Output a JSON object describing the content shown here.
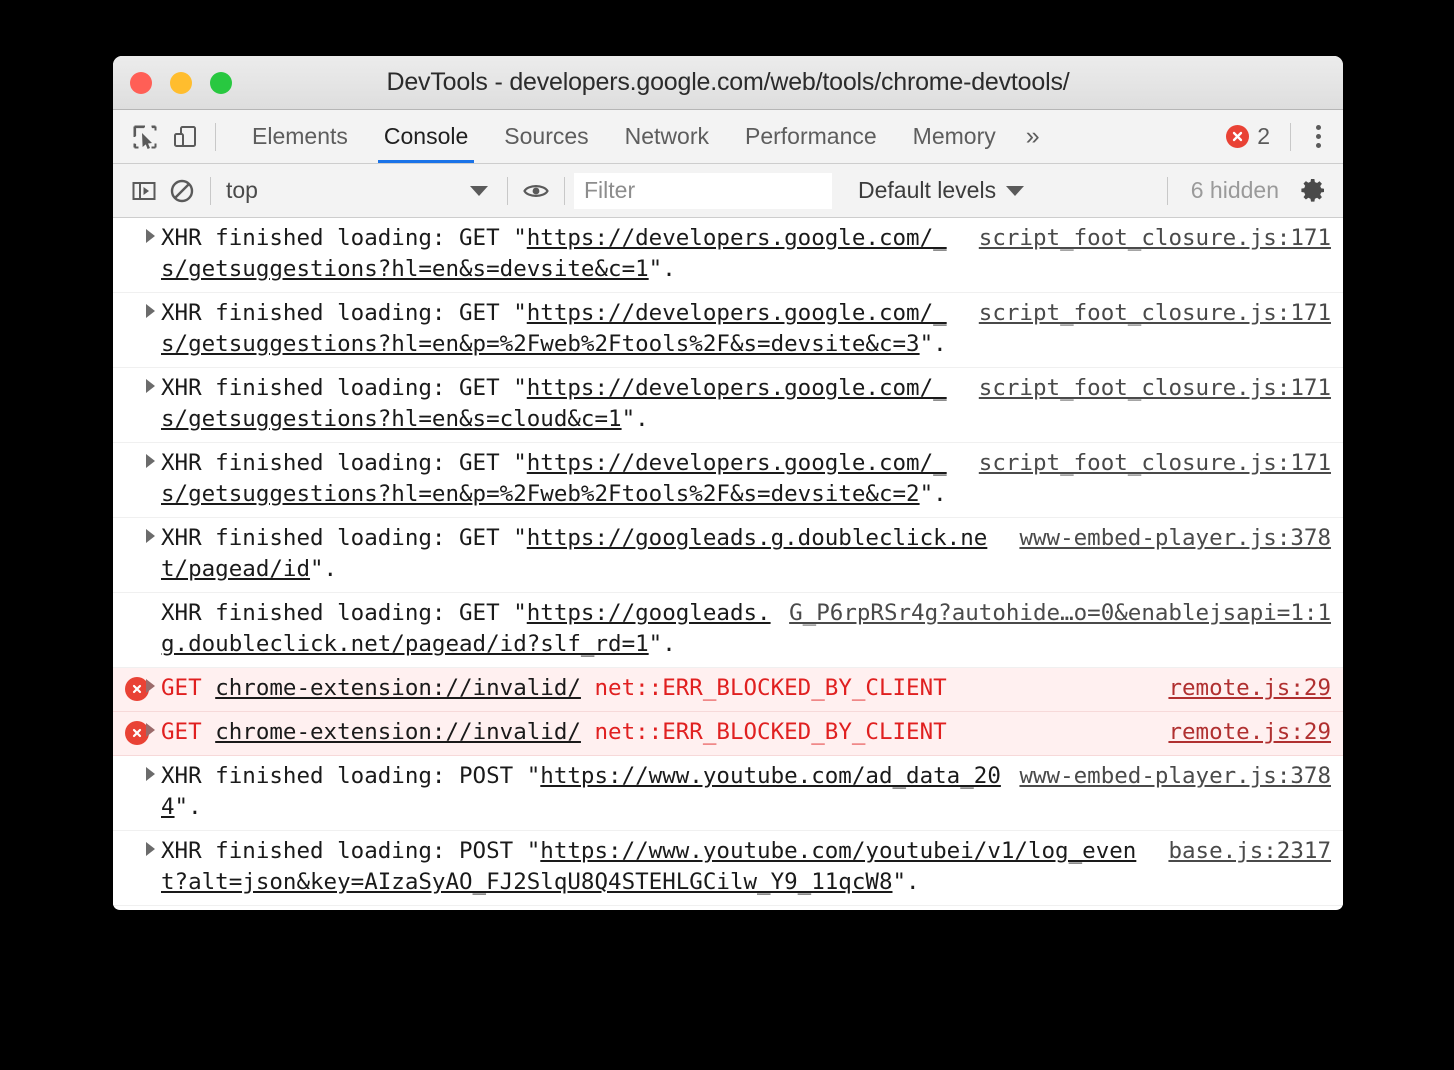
{
  "window": {
    "title": "DevTools - developers.google.com/web/tools/chrome-devtools/",
    "traffic_lights": {
      "close": "close-button",
      "minimize": "minimize-button",
      "zoom": "zoom-button"
    }
  },
  "tabbar": {
    "inspect_icon": "inspect-element-icon",
    "device_icon": "device-toolbar-icon",
    "tabs": [
      {
        "label": "Elements",
        "active": false
      },
      {
        "label": "Console",
        "active": true
      },
      {
        "label": "Sources",
        "active": false
      },
      {
        "label": "Network",
        "active": false
      },
      {
        "label": "Performance",
        "active": false
      },
      {
        "label": "Memory",
        "active": false
      }
    ],
    "more_tabs_label": "»",
    "error_count": "2",
    "error_icon": "error-circle-icon",
    "menu_icon": "kebab-menu-icon"
  },
  "filterbar": {
    "sidebar_icon": "console-sidebar-icon",
    "clear_icon": "clear-console-icon",
    "context": "top",
    "eye_icon": "live-expression-eye-icon",
    "filter_placeholder": "Filter",
    "filter_value": "",
    "levels": "Default levels",
    "hidden": "6 hidden",
    "settings_icon": "settings-gear-icon"
  },
  "console": {
    "messages": [
      {
        "id": "msg-1",
        "type": "info",
        "expandable": true,
        "prefix": "XHR finished loading: GET \"",
        "link": "https://developers.google.com/_s/getsuggestions?hl=en&s=devsite&c=1",
        "suffix": "\".",
        "source": "script_foot_closure.js:171"
      },
      {
        "id": "msg-2",
        "type": "info",
        "expandable": true,
        "prefix": "XHR finished loading: GET \"",
        "link": "https://developers.google.com/_s/getsuggestions?hl=en&p=%2Fweb%2Ftools%2F&s=devsite&c=3",
        "suffix": "\".",
        "source": "script_foot_closure.js:171"
      },
      {
        "id": "msg-3",
        "type": "info",
        "expandable": true,
        "prefix": "XHR finished loading: GET \"",
        "link": "https://developers.google.com/_s/getsuggestions?hl=en&s=cloud&c=1",
        "suffix": "\".",
        "source": "script_foot_closure.js:171"
      },
      {
        "id": "msg-4",
        "type": "info",
        "expandable": true,
        "prefix": "XHR finished loading: GET \"",
        "link": "https://developers.google.com/_s/getsuggestions?hl=en&p=%2Fweb%2Ftools%2F&s=devsite&c=2",
        "suffix": "\".",
        "source": "script_foot_closure.js:171"
      },
      {
        "id": "msg-5",
        "type": "info",
        "expandable": true,
        "prefix": "XHR finished loading: GET \"",
        "link": "https://googleads.g.doubleclick.net/pagead/id",
        "suffix": "\".",
        "source": "www-embed-player.js:378"
      },
      {
        "id": "msg-6",
        "type": "info",
        "expandable": false,
        "prefix": "XHR finished loading: GET \"",
        "link": "https://googleads.g.doubleclick.net/pagead/id?slf_rd=1",
        "suffix": "\".",
        "source": "G_P6rpRSr4g?autohide…o=0&enablejsapi=1:1"
      },
      {
        "id": "msg-7",
        "type": "error",
        "expandable": true,
        "prefix": "GET ",
        "link": "chrome-extension://invalid/",
        "suffix": " net::ERR_BLOCKED_BY_CLIENT",
        "source": "remote.js:29"
      },
      {
        "id": "msg-8",
        "type": "error",
        "expandable": true,
        "prefix": "GET ",
        "link": "chrome-extension://invalid/",
        "suffix": " net::ERR_BLOCKED_BY_CLIENT",
        "source": "remote.js:29"
      },
      {
        "id": "msg-9",
        "type": "info",
        "expandable": true,
        "prefix": "XHR finished loading: POST \"",
        "link": "https://www.youtube.com/ad_data_204",
        "suffix": "\".",
        "source": "www-embed-player.js:378"
      },
      {
        "id": "msg-10",
        "type": "info",
        "expandable": true,
        "prefix": "XHR finished loading: POST \"",
        "link": "https://www.youtube.com/youtubei/v1/log_event?alt=json&key=AIzaSyAO_FJ2SlqU8Q4STEHLGCilw_Y9_11qcW8",
        "suffix": "\".",
        "source": "base.js:2317"
      }
    ],
    "prompt_caret": "❯"
  },
  "colors": {
    "accent": "#1a73e8",
    "error": "#e94235",
    "error_text": "#e02020",
    "error_row_bg": "#fff0f0",
    "toolbar_bg": "#f3f3f3"
  }
}
